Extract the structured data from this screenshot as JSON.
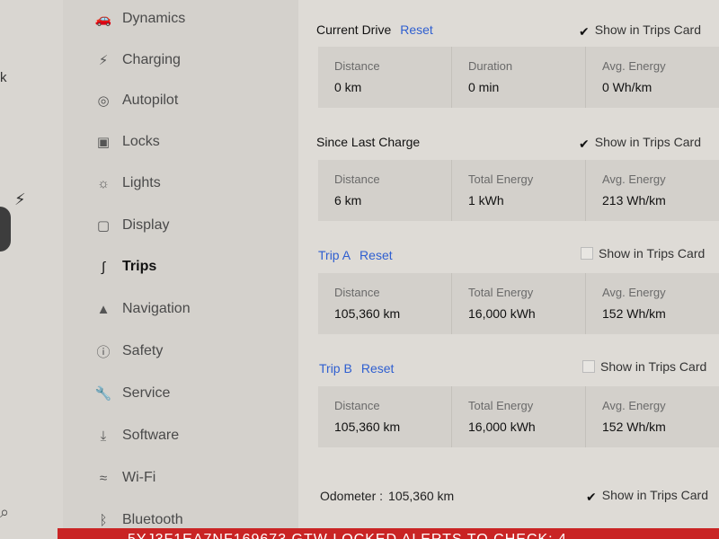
{
  "edge": {
    "partial_text": "k",
    "bolt_glyph": "⚡"
  },
  "sidebar": {
    "items": [
      {
        "label": "Dynamics",
        "icon": "car-dynamics-icon"
      },
      {
        "label": "Charging",
        "icon": "bolt-icon"
      },
      {
        "label": "Autopilot",
        "icon": "steering-wheel-icon"
      },
      {
        "label": "Locks",
        "icon": "lock-icon"
      },
      {
        "label": "Lights",
        "icon": "sun-icon"
      },
      {
        "label": "Display",
        "icon": "display-icon"
      },
      {
        "label": "Trips",
        "icon": "trips-icon",
        "active": true
      },
      {
        "label": "Navigation",
        "icon": "navigation-arrow-icon"
      },
      {
        "label": "Safety",
        "icon": "safety-icon"
      },
      {
        "label": "Service",
        "icon": "wrench-icon"
      },
      {
        "label": "Software",
        "icon": "download-icon"
      },
      {
        "label": "Wi-Fi",
        "icon": "wifi-icon"
      },
      {
        "label": "Bluetooth",
        "icon": "bluetooth-icon"
      }
    ]
  },
  "current_drive": {
    "title": "Current Drive",
    "reset": "Reset",
    "show_label": "Show in Trips Card",
    "checked": true,
    "stats": [
      {
        "caption": "Distance",
        "value": "0 km"
      },
      {
        "caption": "Duration",
        "value": "0 min"
      },
      {
        "caption": "Avg. Energy",
        "value": "0 Wh/km"
      }
    ]
  },
  "since_last_charge": {
    "title": "Since Last Charge",
    "show_label": "Show in Trips Card",
    "checked": true,
    "stats": [
      {
        "caption": "Distance",
        "value": "6 km"
      },
      {
        "caption": "Total Energy",
        "value": "1 kWh"
      },
      {
        "caption": "Avg. Energy",
        "value": "213 Wh/km"
      }
    ]
  },
  "trip_a": {
    "title": "Trip A",
    "reset": "Reset",
    "show_label": "Show in Trips Card",
    "checked": false,
    "stats": [
      {
        "caption": "Distance",
        "value": "105,360 km"
      },
      {
        "caption": "Total Energy",
        "value": "16,000 kWh"
      },
      {
        "caption": "Avg. Energy",
        "value": "152 Wh/km"
      }
    ]
  },
  "trip_b": {
    "title": "Trip B",
    "reset": "Reset",
    "show_label": "Show in Trips Card",
    "checked": false,
    "stats": [
      {
        "caption": "Distance",
        "value": "105,360 km"
      },
      {
        "caption": "Total Energy",
        "value": "16,000 kWh"
      },
      {
        "caption": "Avg. Energy",
        "value": "152 Wh/km"
      }
    ]
  },
  "odometer": {
    "label": "Odometer :",
    "value": "105,360 km",
    "show_label": "Show in Trips Card",
    "checked": true
  },
  "alert_bar": {
    "text": "5YJ3F1EA7NF169673   GTW LOCKED   ALERTS TO CHECK: 4",
    "color": "#c92424"
  },
  "colors": {
    "link": "#2f5fd0",
    "active_text": "#111111",
    "alert": "#c92424"
  }
}
